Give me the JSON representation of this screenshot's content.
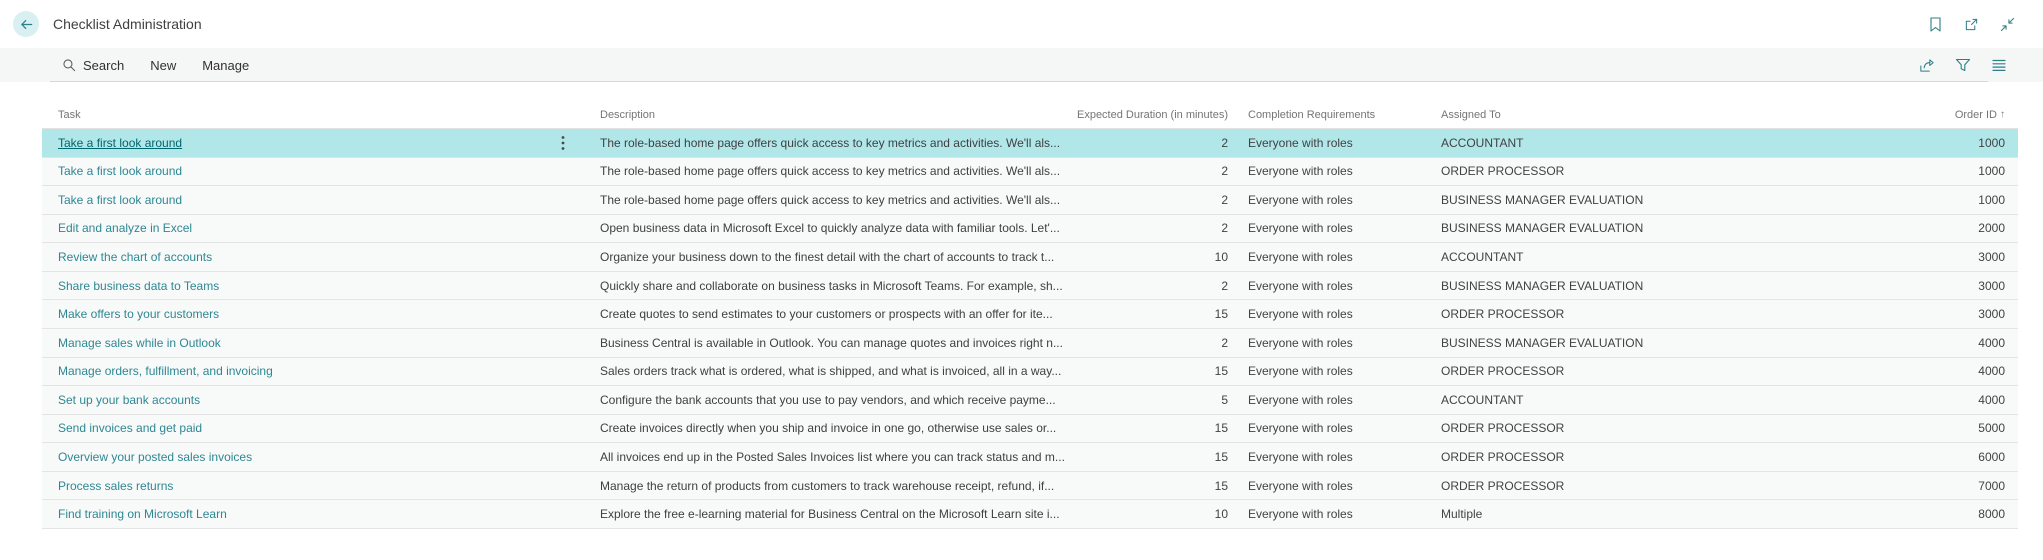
{
  "header": {
    "title": "Checklist Administration",
    "icons": [
      "back-arrow",
      "bookmark",
      "open-in-new-window",
      "collapse-window"
    ]
  },
  "toolbar": {
    "search_label": "Search",
    "new_label": "New",
    "manage_label": "Manage",
    "right_icons": [
      "share",
      "filter",
      "choose-view-options"
    ]
  },
  "table": {
    "columns": {
      "task": "Task",
      "description": "Description",
      "duration": "Expected Duration (in minutes)",
      "completion": "Completion Requirements",
      "assigned": "Assigned To",
      "order_id": "Order ID",
      "order_id_sort": "↑"
    },
    "rows": [
      {
        "selected": true,
        "task": "Take a first look around",
        "description": "The role-based home page offers quick access to key metrics and activities. We'll als...",
        "duration": "2",
        "completion": "Everyone with roles",
        "assigned_to": "ACCOUNTANT",
        "order_id": "1000"
      },
      {
        "selected": false,
        "task": "Take a first look around",
        "description": "The role-based home page offers quick access to key metrics and activities. We'll als...",
        "duration": "2",
        "completion": "Everyone with roles",
        "assigned_to": "ORDER PROCESSOR",
        "order_id": "1000"
      },
      {
        "selected": false,
        "task": "Take a first look around",
        "description": "The role-based home page offers quick access to key metrics and activities. We'll als...",
        "duration": "2",
        "completion": "Everyone with roles",
        "assigned_to": "BUSINESS MANAGER EVALUATION",
        "order_id": "1000"
      },
      {
        "selected": false,
        "task": "Edit and analyze in Excel",
        "description": "Open business data in Microsoft Excel to quickly analyze data with familiar tools. Let'...",
        "duration": "2",
        "completion": "Everyone with roles",
        "assigned_to": "BUSINESS MANAGER EVALUATION",
        "order_id": "2000"
      },
      {
        "selected": false,
        "task": "Review the chart of accounts",
        "description": "Organize your business down to the finest detail with the chart of accounts to track t...",
        "duration": "10",
        "completion": "Everyone with roles",
        "assigned_to": "ACCOUNTANT",
        "order_id": "3000"
      },
      {
        "selected": false,
        "task": "Share business data to Teams",
        "description": "Quickly share and collaborate on business tasks in Microsoft Teams. For example, sh...",
        "duration": "2",
        "completion": "Everyone with roles",
        "assigned_to": "BUSINESS MANAGER EVALUATION",
        "order_id": "3000"
      },
      {
        "selected": false,
        "task": "Make offers to your customers",
        "description": "Create quotes to send estimates to your customers or prospects with an offer for ite...",
        "duration": "15",
        "completion": "Everyone with roles",
        "assigned_to": "ORDER PROCESSOR",
        "order_id": "3000"
      },
      {
        "selected": false,
        "task": "Manage sales while in Outlook",
        "description": "Business Central is available in Outlook. You can manage quotes and invoices right n...",
        "duration": "2",
        "completion": "Everyone with roles",
        "assigned_to": "BUSINESS MANAGER EVALUATION",
        "order_id": "4000"
      },
      {
        "selected": false,
        "task": "Manage orders, fulfillment, and invoicing",
        "description": "Sales orders track what is ordered, what is shipped, and what is invoiced, all in a way...",
        "duration": "15",
        "completion": "Everyone with roles",
        "assigned_to": "ORDER PROCESSOR",
        "order_id": "4000"
      },
      {
        "selected": false,
        "task": "Set up your bank accounts",
        "description": "Configure the bank accounts that you use to pay vendors, and which receive payme...",
        "duration": "5",
        "completion": "Everyone with roles",
        "assigned_to": "ACCOUNTANT",
        "order_id": "4000"
      },
      {
        "selected": false,
        "task": "Send invoices and get paid",
        "description": "Create invoices directly when you ship and invoice in one go, otherwise use sales or...",
        "duration": "15",
        "completion": "Everyone with roles",
        "assigned_to": "ORDER PROCESSOR",
        "order_id": "5000"
      },
      {
        "selected": false,
        "task": "Overview your posted sales invoices",
        "description": "All invoices end up in the Posted Sales Invoices list where you can track status and m...",
        "duration": "15",
        "completion": "Everyone with roles",
        "assigned_to": "ORDER PROCESSOR",
        "order_id": "6000"
      },
      {
        "selected": false,
        "task": "Process sales returns",
        "description": "Manage the return of products from customers to track warehouse receipt, refund, if...",
        "duration": "15",
        "completion": "Everyone with roles",
        "assigned_to": "ORDER PROCESSOR",
        "order_id": "7000"
      },
      {
        "selected": false,
        "task": "Find training on Microsoft Learn",
        "description": "Explore the free e-learning material for Business Central on the Microsoft Learn site i...",
        "duration": "10",
        "completion": "Everyone with roles",
        "assigned_to": "Multiple",
        "order_id": "8000"
      }
    ]
  },
  "colors": {
    "accent_teal": "#2c7f88",
    "selection_background": "#b1e7e9",
    "link_teal": "#2d8893",
    "back_button_background": "#d9f0f2",
    "toolbar_background": "#f5f6f6"
  }
}
